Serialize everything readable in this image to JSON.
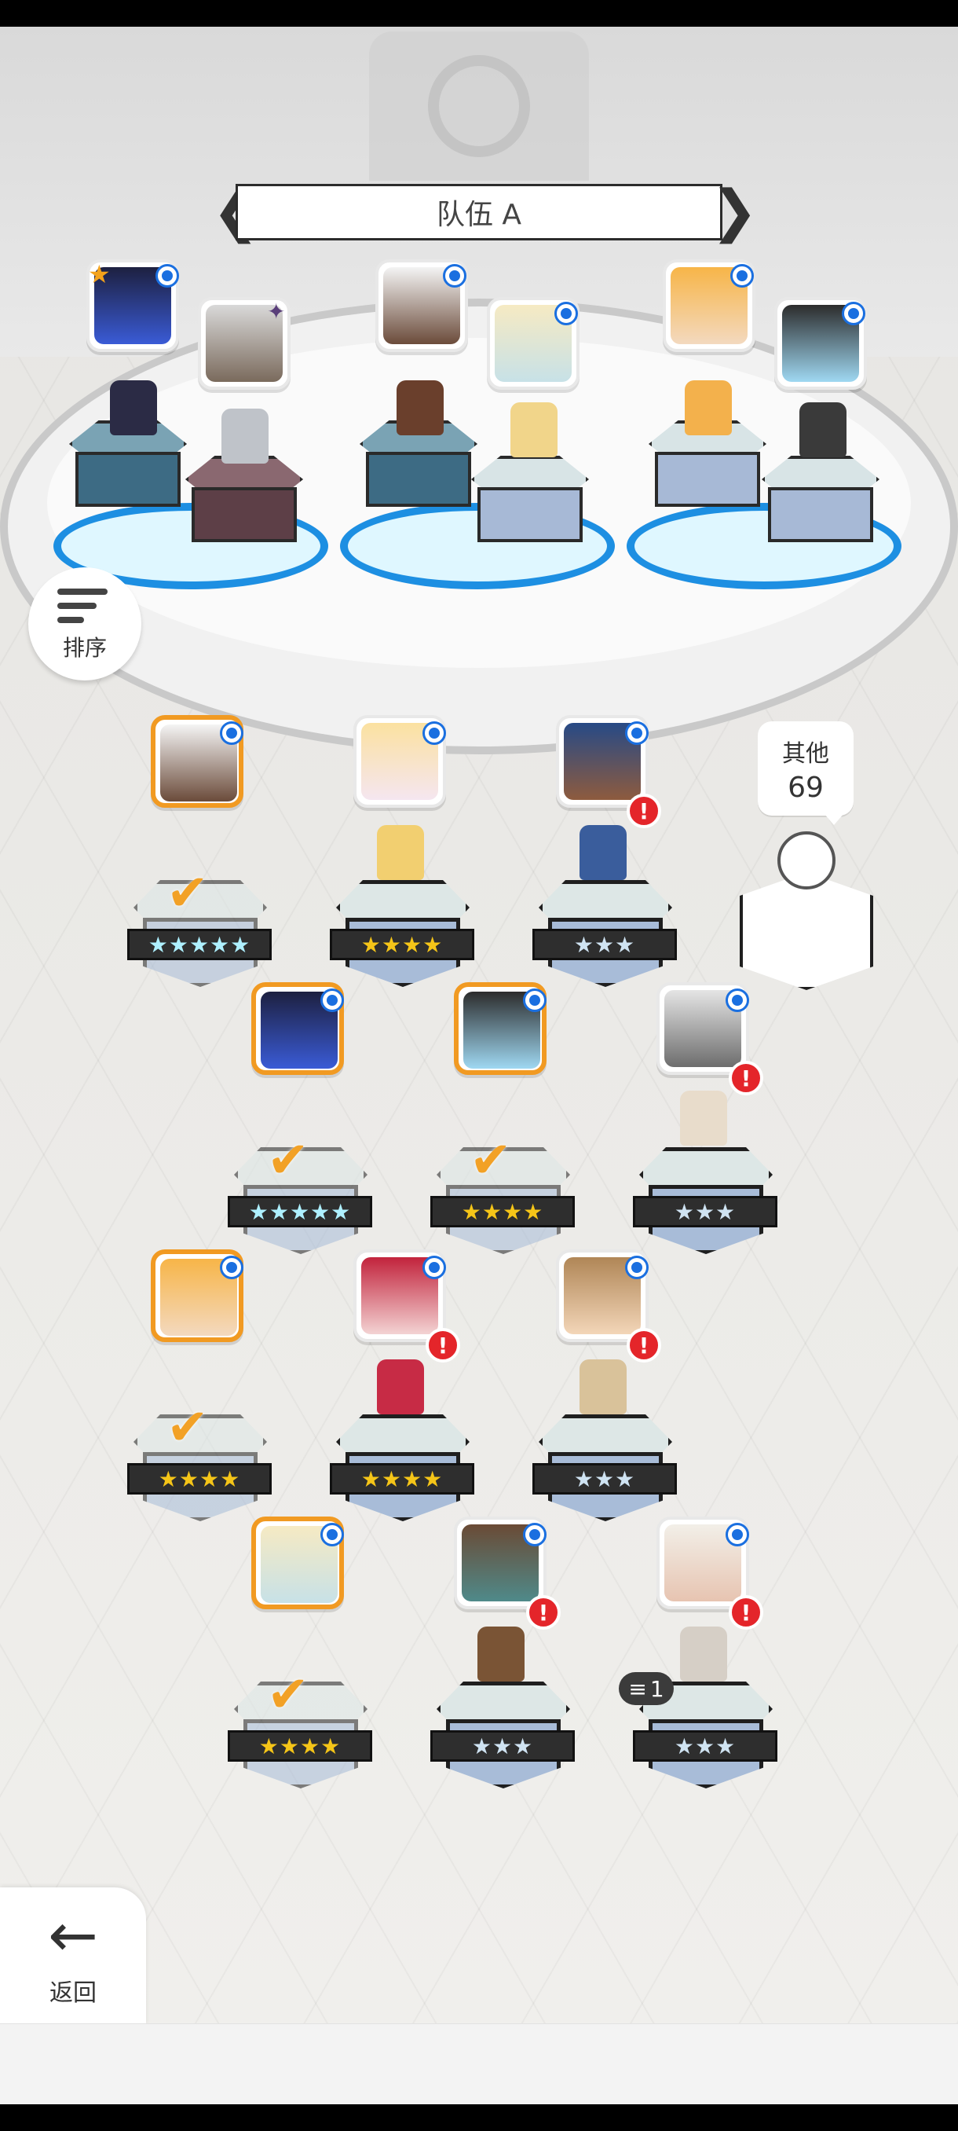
{
  "team": {
    "title": "队伍 A"
  },
  "controls": {
    "sort_label": "排序",
    "back_label": "返回"
  },
  "other": {
    "label": "其他",
    "count": "69"
  },
  "colors": {
    "selected_border": "#f19a22",
    "alert": "#e4252a",
    "pad_blue": "#1d8fe2",
    "star_gold": "#f5c518"
  },
  "team_slots": [
    {
      "name": "black-hair-girl",
      "leader": true
    },
    {
      "name": "grey-beard-warrior"
    },
    {
      "name": "dark-skin-white-hair"
    },
    {
      "name": "blonde-knight"
    },
    {
      "name": "orange-hair-boy"
    },
    {
      "name": "hooded-mage"
    }
  ],
  "roster": [
    {
      "name": "dark-skin-white-hair",
      "stars": "★★★★★",
      "tier": "rainbow",
      "selected": true
    },
    {
      "name": "blonde-princess",
      "stars": "★★★★",
      "tier": "gold",
      "selected": false
    },
    {
      "name": "blue-bandana-brute",
      "stars": "★★★",
      "tier": "silver",
      "selected": false,
      "alert": "!"
    },
    {
      "name": "black-hair-girl",
      "stars": "★★★★★",
      "tier": "rainbow",
      "selected": true
    },
    {
      "name": "hooded-mage",
      "stars": "★★★★",
      "tier": "gold",
      "selected": true
    },
    {
      "name": "wolf-beast",
      "stars": "★★★",
      "tier": "silver",
      "selected": false,
      "alert": "!"
    },
    {
      "name": "orange-hair-boy",
      "stars": "★★★★",
      "tier": "gold",
      "selected": true
    },
    {
      "name": "red-hair-girl",
      "stars": "★★★★",
      "tier": "gold",
      "selected": false,
      "alert": "!"
    },
    {
      "name": "surprised-goggles-girl",
      "stars": "★★★",
      "tier": "silver",
      "selected": false,
      "alert": "!"
    },
    {
      "name": "blonde-knight",
      "stars": "★★★★",
      "tier": "gold",
      "selected": true
    },
    {
      "name": "cowboy-hat-man",
      "stars": "★★★",
      "tier": "silver",
      "selected": false,
      "alert": "!"
    },
    {
      "name": "white-hood-nun",
      "stars": "★★★",
      "tier": "silver",
      "selected": false,
      "alert": "!"
    }
  ],
  "stack_badge": {
    "count": "1"
  }
}
